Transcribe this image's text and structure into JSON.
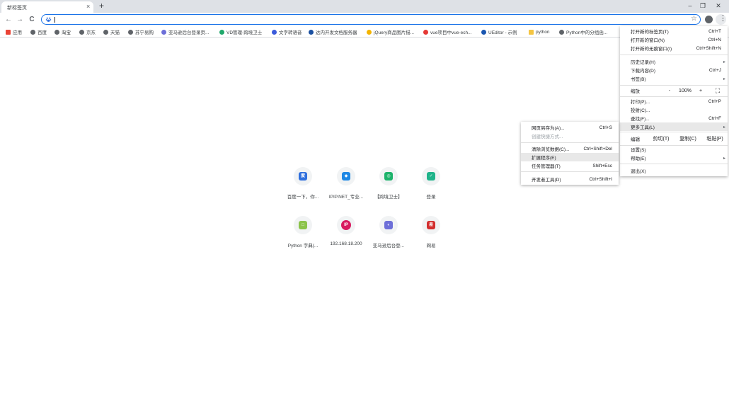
{
  "tab": {
    "title": "新标签页",
    "close": "×",
    "new_tab": "+"
  },
  "window_controls": {
    "minimize": "–",
    "maximize": "❐",
    "close": "✕"
  },
  "toolbar": {
    "back": "←",
    "forward": "→",
    "reload": "C",
    "star": "☆",
    "menu": "⋮"
  },
  "omnibox": {
    "value": "",
    "icon": "baidu-paw-icon"
  },
  "bookmarks": [
    {
      "label": "应用",
      "icon": "apps-grid-icon",
      "color": "#ea4335"
    },
    {
      "label": "百度",
      "icon": "globe-icon",
      "color": "#5f6368"
    },
    {
      "label": "淘宝",
      "icon": "globe-icon",
      "color": "#5f6368"
    },
    {
      "label": "京东",
      "icon": "globe-icon",
      "color": "#5f6368"
    },
    {
      "label": "天猫",
      "icon": "globe-icon",
      "color": "#5f6368"
    },
    {
      "label": "苏宁易购",
      "icon": "globe-icon",
      "color": "#5f6368"
    },
    {
      "label": "亚马逊后台登录页...",
      "icon": "site-icon",
      "color": "#6d6fd8"
    },
    {
      "label": "VD管理-跨境卫士",
      "icon": "shield-icon",
      "color": "#20a86b"
    },
    {
      "label": "文字转语音",
      "icon": "mic-icon",
      "color": "#3b5bdb"
    },
    {
      "label": "达内开发文档服务器",
      "icon": "tarena-icon",
      "color": "#1a4fa0"
    },
    {
      "label": "jQuery商品图片描...",
      "icon": "page-icon",
      "color": "#f4b400"
    },
    {
      "label": "vue项目中vue-ech...",
      "icon": "csdn-icon",
      "color": "#e53935"
    },
    {
      "label": "UEditor - 示例",
      "icon": "ueditor-icon",
      "color": "#1a56b0"
    },
    {
      "label": "python",
      "icon": "folder-icon",
      "color": "#f4c542"
    },
    {
      "label": "Python中的分组函...",
      "icon": "cnblogs-icon",
      "color": "#5f6368"
    }
  ],
  "tiles": [
    {
      "label": "百度一下，你...",
      "icon": "baidu-icon",
      "glyph": "度",
      "color": "#2f6fdd"
    },
    {
      "label": "IPIP.NET_专业...",
      "icon": "ipip-icon",
      "glyph": "◆",
      "color": "#1e88e5"
    },
    {
      "label": "【跨境卫士】",
      "icon": "kuajing-icon",
      "glyph": "◎",
      "color": "#1db36b"
    },
    {
      "label": "登录",
      "icon": "shield-check-icon",
      "glyph": "✓",
      "color": "#1fb38a"
    },
    {
      "label": "Python 字典(...",
      "icon": "runoob-icon",
      "glyph": "□",
      "color": "#8bc34a"
    },
    {
      "label": "192.168.18.200",
      "icon": "ip-icon",
      "glyph": "IP",
      "color": "#d81b60"
    },
    {
      "label": "亚马逊后台登...",
      "icon": "amazon-site-icon",
      "glyph": "◐",
      "color": "#6d6fd8"
    },
    {
      "label": "网易",
      "icon": "netease-icon",
      "glyph": "易",
      "color": "#d32f2f"
    }
  ],
  "main_menu": {
    "items1": [
      {
        "label": "打开新的标签页(T)",
        "shortcut": "Ctrl+T"
      },
      {
        "label": "打开新的窗口(N)",
        "shortcut": "Ctrl+N"
      },
      {
        "label": "打开新的无痕窗口(I)",
        "shortcut": "Ctrl+Shift+N"
      }
    ],
    "items2": [
      {
        "label": "历史记录(H)",
        "arrow": "▸"
      },
      {
        "label": "下载内容(D)",
        "shortcut": "Ctrl+J"
      },
      {
        "label": "书签(B)",
        "arrow": "▸"
      }
    ],
    "zoom": {
      "label": "缩放",
      "minus": "-",
      "value": "100%",
      "plus": "+",
      "fullscreen": "⛶"
    },
    "items3": [
      {
        "label": "打印(P)...",
        "shortcut": "Ctrl+P"
      },
      {
        "label": "投射(C)..."
      },
      {
        "label": "查找(F)...",
        "shortcut": "Ctrl+F"
      },
      {
        "label": "更多工具(L)",
        "arrow": "▸"
      }
    ],
    "edit": {
      "label": "编辑",
      "cut": "剪切(T)",
      "copy": "复制(C)",
      "paste": "粘贴(P)"
    },
    "items4": [
      {
        "label": "设置(S)"
      },
      {
        "label": "帮助(E)",
        "arrow": "▸"
      }
    ],
    "exit": {
      "label": "退出(X)"
    }
  },
  "more_tools_menu": {
    "items1": [
      {
        "label": "网页另存为(A)...",
        "shortcut": "Ctrl+S"
      },
      {
        "label": "创建快捷方式..."
      }
    ],
    "items2": [
      {
        "label": "清除浏览数据(C)...",
        "shortcut": "Ctrl+Shift+Del"
      },
      {
        "label": "扩展程序(E)"
      },
      {
        "label": "任务管理器(T)",
        "shortcut": "Shift+Esc"
      }
    ],
    "items3": [
      {
        "label": "开发者工具(D)",
        "shortcut": "Ctrl+Shift+I"
      }
    ]
  }
}
